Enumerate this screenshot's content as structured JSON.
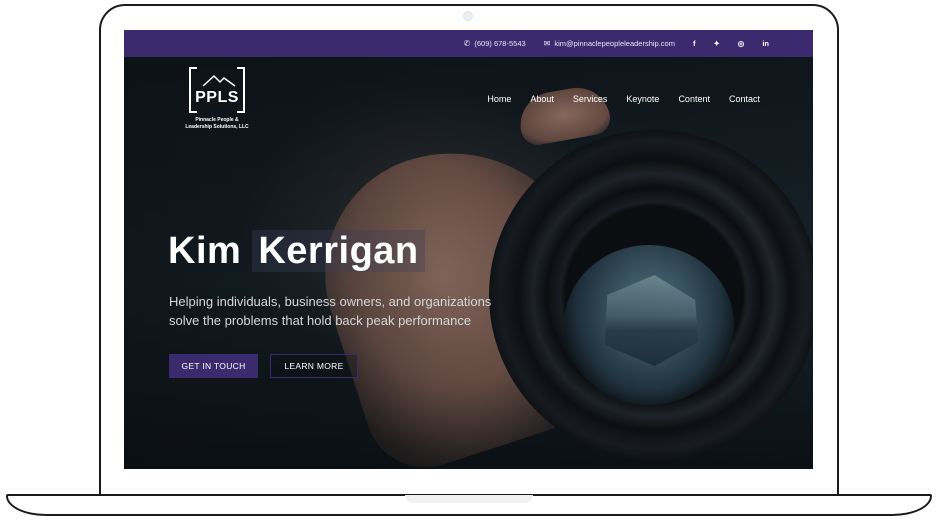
{
  "topbar": {
    "phone": "(609) 678-5543",
    "email": "kim@pinnaclepeopleleadership.com",
    "social": [
      "f",
      "t",
      "ig",
      "in"
    ]
  },
  "logo": {
    "mark": "PPLS",
    "line1": "Pinnacle People &",
    "line2": "Leadership Solutions, LLC"
  },
  "nav": {
    "items": [
      "Home",
      "About",
      "Services",
      "Keynote",
      "Content",
      "Contact"
    ]
  },
  "hero": {
    "first_name": "Kim",
    "last_name": "Kerrigan",
    "tagline_1": "Helping individuals, business owners, and organizations",
    "tagline_2": "solve the problems that hold back peak performance",
    "cta_primary": "GET IN TOUCH",
    "cta_secondary": "LEARN MORE"
  },
  "colors": {
    "brand_purple": "#3b2a6e",
    "text_white": "#ffffff"
  },
  "icons": [
    "phone-icon",
    "envelope-icon",
    "facebook-icon",
    "twitter-icon",
    "instagram-icon",
    "linkedin-icon"
  ]
}
